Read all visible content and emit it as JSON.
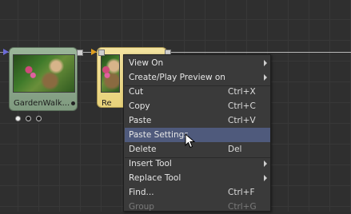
{
  "nodes": [
    {
      "id": "garden",
      "label": "GardenWalk...",
      "color": "#8fa98f"
    },
    {
      "id": "rep",
      "label": "Re",
      "color": "#eedb8c"
    }
  ],
  "context_menu": {
    "items": [
      {
        "label": "View On",
        "shortcut": "",
        "submenu": true,
        "highlighted": false,
        "disabled": false
      },
      {
        "label": "Create/Play Preview on",
        "shortcut": "",
        "submenu": true,
        "highlighted": false,
        "disabled": false
      },
      {
        "label": "Cut",
        "shortcut": "Ctrl+X",
        "submenu": false,
        "highlighted": false,
        "disabled": false
      },
      {
        "label": "Copy",
        "shortcut": "Ctrl+C",
        "submenu": false,
        "highlighted": false,
        "disabled": false
      },
      {
        "label": "Paste",
        "shortcut": "Ctrl+V",
        "submenu": false,
        "highlighted": false,
        "disabled": false
      },
      {
        "label": "Paste Settings",
        "shortcut": "",
        "submenu": false,
        "highlighted": true,
        "disabled": false
      },
      {
        "label": "Delete",
        "shortcut": "Del",
        "submenu": false,
        "highlighted": false,
        "disabled": false
      },
      {
        "label": "Insert Tool",
        "shortcut": "",
        "submenu": true,
        "highlighted": false,
        "disabled": false
      },
      {
        "label": "Replace Tool",
        "shortcut": "",
        "submenu": true,
        "highlighted": false,
        "disabled": false
      },
      {
        "label": "Find...",
        "shortcut": "Ctrl+F",
        "submenu": false,
        "highlighted": false,
        "disabled": false
      },
      {
        "label": "Group",
        "shortcut": "Ctrl+G",
        "submenu": false,
        "highlighted": false,
        "disabled": true
      }
    ]
  },
  "colors": {
    "highlight": "#4f5a7c",
    "menu_bg": "#3a3a3a",
    "canvas_bg": "#2f2f2f"
  }
}
